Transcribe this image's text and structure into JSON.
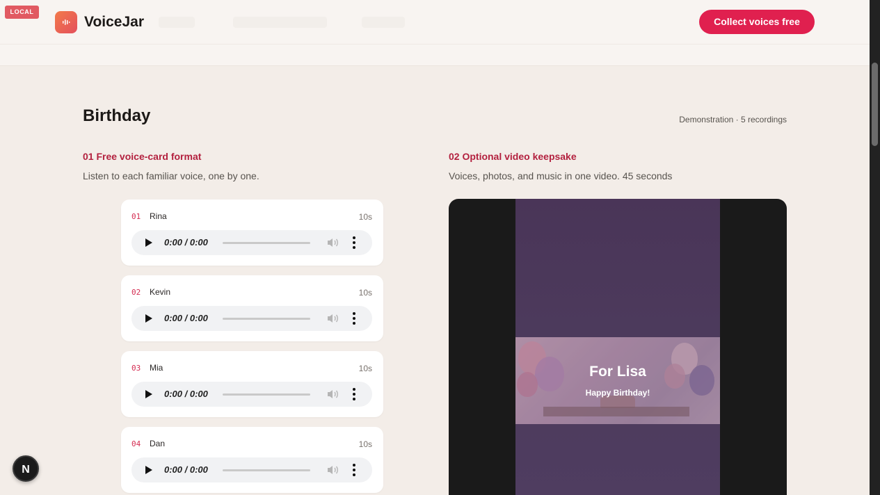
{
  "header": {
    "badge": "LOCAL",
    "brand": "VoiceJar",
    "cta_label": "Collect voices free"
  },
  "page": {
    "title": "Birthday",
    "meta": "Demonstration · 5 recordings"
  },
  "sections": [
    {
      "title": "01 Free voice-card format",
      "description": "Listen to each familiar voice, one by one."
    },
    {
      "title": "02 Optional video keepsake",
      "description": "Voices, photos, and music in one video. 45 seconds"
    }
  ],
  "recordings": [
    {
      "num": "01",
      "name": "Rina",
      "duration": "10s",
      "time": "0:00 / 0:00"
    },
    {
      "num": "02",
      "name": "Kevin",
      "duration": "10s",
      "time": "0:00 / 0:00"
    },
    {
      "num": "03",
      "name": "Mia",
      "duration": "10s",
      "time": "0:00 / 0:00"
    },
    {
      "num": "04",
      "name": "Dan",
      "duration": "10s",
      "time": "0:00 / 0:00"
    }
  ],
  "video": {
    "headline": "For Lisa",
    "subline": "Happy Birthday!"
  },
  "dev_button": "N",
  "colors": {
    "accent": "#e0204f",
    "section_title": "#b3213f",
    "badge": "#e15a62",
    "background": "#f3ede8"
  },
  "icons": [
    "voice-wave-icon",
    "play-icon",
    "volume-icon",
    "more-vertical-icon"
  ]
}
